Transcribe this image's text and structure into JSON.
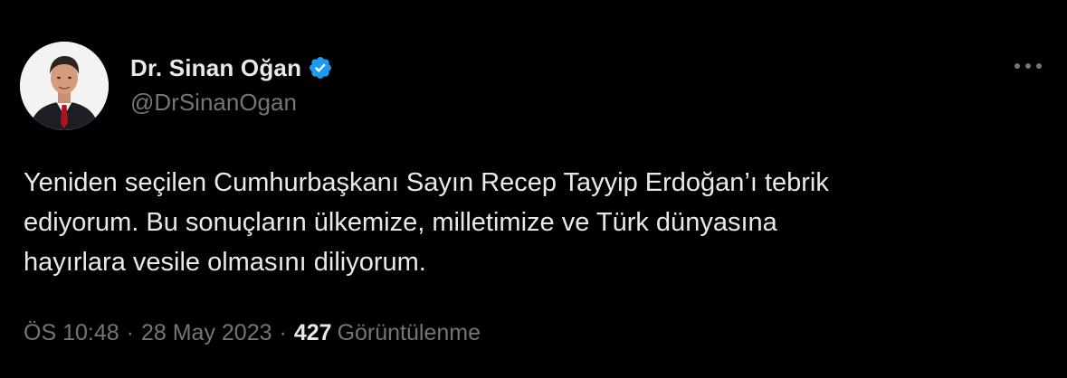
{
  "author": {
    "display_name": "Dr. Sinan Oğan",
    "handle": "@DrSinanOgan",
    "verified": true,
    "verified_icon": "verified-badge-icon",
    "avatar_icon": "profile-photo"
  },
  "more_icon": "more-options-icon",
  "tweet": {
    "text": "Yeniden seçilen Cumhurbaşkanı Sayın Recep Tayyip Erdoğan’ı tebrik\nediyorum. Bu sonuçların ülkemize, milletimize ve Türk dünyasına\nhayırlara vesile olmasını diliyorum."
  },
  "meta": {
    "time": "ÖS 10:48",
    "separator": "·",
    "date": "28 May 2023",
    "views_count": "427",
    "views_label": "Görüntülenme"
  },
  "colors": {
    "background": "#000000",
    "primary_text": "#e7e9ea",
    "secondary_text": "#71767b",
    "verified_blue": "#1d9bf0"
  }
}
